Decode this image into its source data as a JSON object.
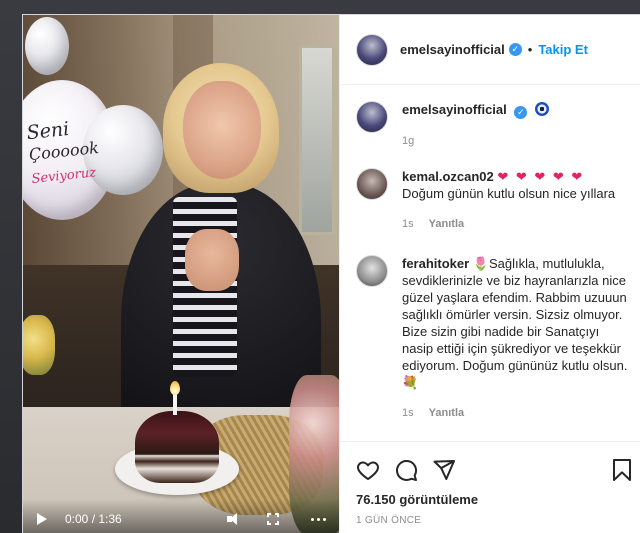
{
  "video": {
    "balloon_text": [
      "Seni",
      "Çoooook",
      "Seviyoruz"
    ],
    "time": "0:00 / 1:36",
    "icons": [
      "play-icon",
      "volume-icon",
      "fullscreen-icon",
      "more-icon"
    ]
  },
  "header": {
    "username": "emelsayinofficial",
    "follow_label": "Takip Et",
    "separator": "•"
  },
  "caption": {
    "username": "emelsayinofficial",
    "emoji": "evil-eye-icon",
    "time": "1g"
  },
  "comments": [
    {
      "username": "kemal.ozcan02",
      "hearts": "❤ ❤ ❤ ❤ ❤",
      "text": "Doğum günün kutlu olsun nice yıllara",
      "time": "1s",
      "reply_label": "Yanıtla"
    },
    {
      "username": "ferahitoker",
      "text": "🌷Sağlıkla, mutlulukla, sevdiklerinizle ve biz hayranlarızla nice güzel yaşlara efendim. Rabbim uzuuun sağlıklı ömürler versin. Sizsiz olmuyor. Bize sizin gibi nadide bir Sanatçıyı nasip ettiği için şükrediyor ve teşekkür ediyorum. Doğum gününüz kutlu olsun.💐",
      "time": "1s",
      "reply_label": "Yanıtla"
    }
  ],
  "actions": {
    "views": "76.150 görüntüleme",
    "posted_ago": "1 GÜN ÖNCE"
  },
  "colors": {
    "accent": "#0095f6",
    "verified": "#3897f0",
    "heart": "#e0245e"
  }
}
